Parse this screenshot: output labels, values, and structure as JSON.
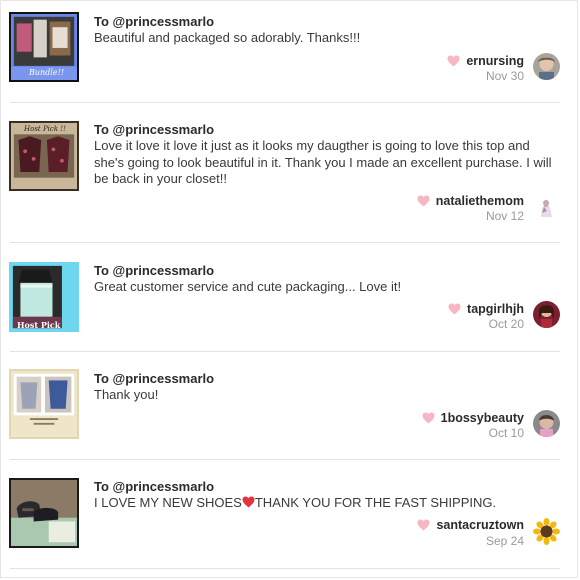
{
  "colors": {
    "heart": "#f6b6c3",
    "divider": "#e2e2e2",
    "date": "#9a9a9a",
    "text": "#3a3a3a"
  },
  "reviews": [
    {
      "to": "To @princessmarlo",
      "comment": "Beautiful and packaged so adorably. Thanks!!!",
      "username": "ernursing",
      "date": "Nov 30",
      "thumb_caption": "Bundle!!"
    },
    {
      "to": "To @princessmarlo",
      "comment": "Love it love it love it just as it looks my daugther is going to love this top and she's going to look beautiful in it. Thank you I made an excellent purchase. I will be back in your closet!!",
      "username": "nataliethemom",
      "date": "Nov 12",
      "thumb_caption": "Host Pick !!"
    },
    {
      "to": "To @princessmarlo",
      "comment": "Great customer service and cute packaging... Love it!",
      "username": "tapgirlhjh",
      "date": "Oct 20",
      "thumb_caption": "Host Pick"
    },
    {
      "to": "To @princessmarlo",
      "comment": "Thank you!",
      "username": "1bossybeauty",
      "date": "Oct 10",
      "thumb_caption": ""
    },
    {
      "to": "To @princessmarlo",
      "comment_before": "I LOVE MY NEW SHOES",
      "comment_after": "THANK YOU FOR THE FAST SHIPPING.",
      "username": "santacruztown",
      "date": "Sep 24",
      "thumb_caption": ""
    }
  ]
}
